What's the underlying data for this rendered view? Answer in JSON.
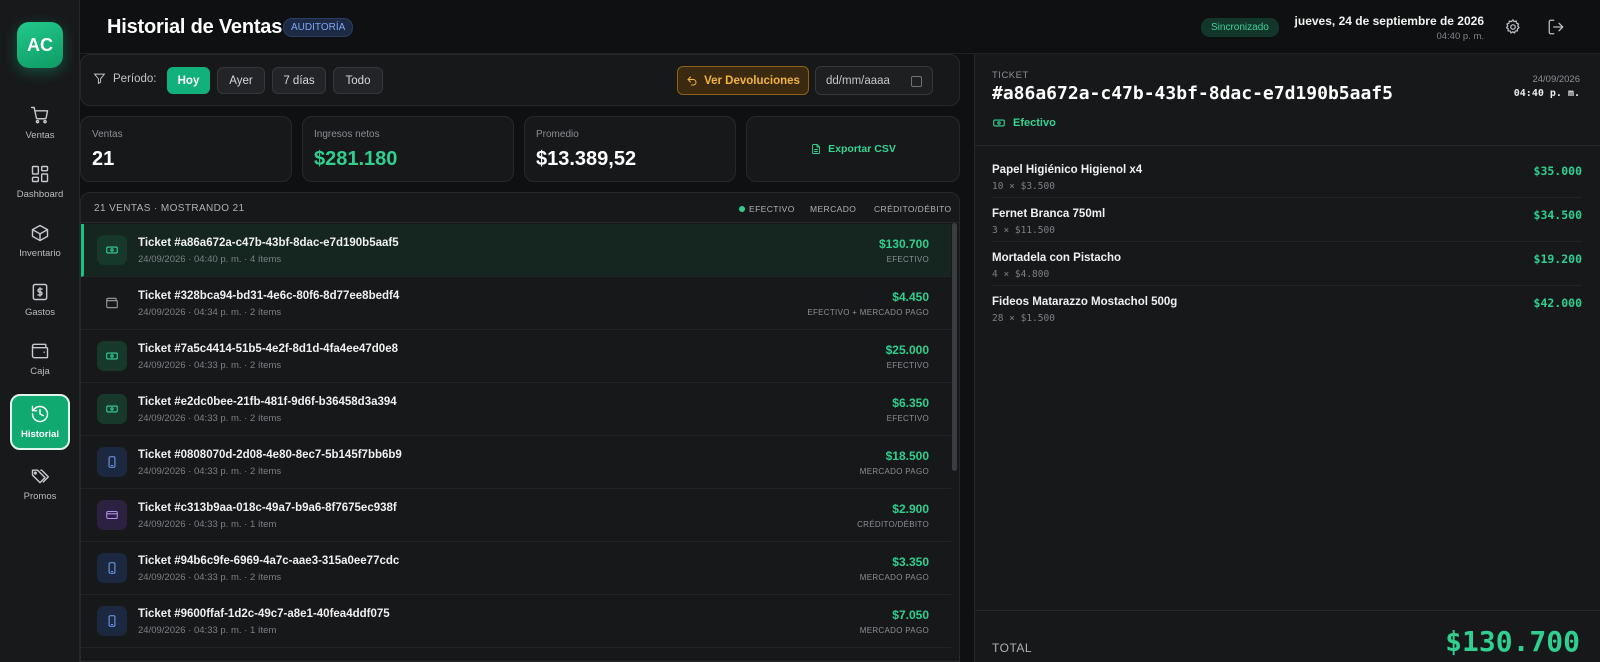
{
  "app": {
    "logo": "AC"
  },
  "sidebar": {
    "items": [
      {
        "label": "Ventas",
        "icon": "cart-icon"
      },
      {
        "label": "Dashboard",
        "icon": "dashboard-icon"
      },
      {
        "label": "Inventario",
        "icon": "box-icon"
      },
      {
        "label": "Gastos",
        "icon": "dollar-icon"
      },
      {
        "label": "Caja",
        "icon": "wallet-icon"
      },
      {
        "label": "Historial",
        "icon": "history-icon",
        "active": true
      },
      {
        "label": "Promos",
        "icon": "tags-icon"
      }
    ]
  },
  "header": {
    "title": "Historial de Ventas",
    "badge": "AUDITORÍA",
    "sync_status": "Sincronizado",
    "date": "jueves, 24 de septiembre de 2026",
    "time": "04:40 p. m."
  },
  "filters": {
    "label": "Período:",
    "periods": [
      "Hoy",
      "Ayer",
      "7 días",
      "Todo"
    ],
    "active_period": "Hoy",
    "returns_button": "Ver Devoluciones",
    "date_placeholder": "dd/mm/aaaa"
  },
  "stats": {
    "sales_label": "Ventas",
    "sales_value": "21",
    "revenue_label": "Ingresos netos",
    "revenue_value": "$281.180",
    "average_label": "Promedio",
    "average_value": "$13.389,52",
    "export_label": "Exportar CSV"
  },
  "list": {
    "count_text": "21 VENTAS · MOSTRANDO 21",
    "legend": [
      "EFECTIVO",
      "MERCADO",
      "CRÉDITO/DÉBITO"
    ],
    "rows": [
      {
        "title": "Ticket #a86a672a-c47b-43bf-8dac-e7d190b5aaf5",
        "sub": "24/09/2026 · 04:40 p. m. · 4 ítems",
        "amount": "$130.700",
        "method": "EFECTIVO",
        "icon": "cash-icon"
      },
      {
        "title": "Ticket #328bca94-bd31-4e6c-80f6-8d77ee8bedf4",
        "sub": "24/09/2026 · 04:34 p. m. · 2 ítems",
        "amount": "$4.450",
        "method": "EFECTIVO + MERCADO PAGO",
        "icon": "wallet-icon"
      },
      {
        "title": "Ticket #7a5c4414-51b5-4e2f-8d1d-4fa4ee47d0e8",
        "sub": "24/09/2026 · 04:33 p. m. · 2 ítems",
        "amount": "$25.000",
        "method": "EFECTIVO",
        "icon": "cash-icon"
      },
      {
        "title": "Ticket #e2dc0bee-21fb-481f-9d6f-b36458d3a394",
        "sub": "24/09/2026 · 04:33 p. m. · 2 ítems",
        "amount": "$6.350",
        "method": "EFECTIVO",
        "icon": "cash-icon"
      },
      {
        "title": "Ticket #0808070d-2d08-4e80-8ec7-5b145f7bb6b9",
        "sub": "24/09/2026 · 04:33 p. m. · 2 ítems",
        "amount": "$18.500",
        "method": "MERCADO PAGO",
        "icon": "phone-icon"
      },
      {
        "title": "Ticket #c313b9aa-018c-49a7-b9a6-8f7675ec938f",
        "sub": "24/09/2026 · 04:33 p. m. · 1 ítem",
        "amount": "$2.900",
        "method": "CRÉDITO/DÉBITO",
        "icon": "credit-card-icon"
      },
      {
        "title": "Ticket #94b6c9fe-6969-4a7c-aae3-315a0ee77cdc",
        "sub": "24/09/2026 · 04:33 p. m. · 2 ítems",
        "amount": "$3.350",
        "method": "MERCADO PAGO",
        "icon": "phone-icon"
      },
      {
        "title": "Ticket #9600ffaf-1d2c-49c7-a8e1-40fea4ddf075",
        "sub": "24/09/2026 · 04:33 p. m. · 1 ítem",
        "amount": "$7.050",
        "method": "MERCADO PAGO",
        "icon": "phone-icon"
      }
    ]
  },
  "detail": {
    "label": "TICKET",
    "id": "#a86a672a-c47b-43bf-8dac-e7d190b5aaf5",
    "date": "24/09/2026",
    "time": "04:40 p. m.",
    "method": "Efectivo",
    "items": [
      {
        "name": "Papel Higiénico Higienol x4",
        "qty": "10 × $3.500",
        "price": "$35.000"
      },
      {
        "name": "Fernet Branca 750ml",
        "qty": "3 × $11.500",
        "price": "$34.500"
      },
      {
        "name": "Mortadela con Pistacho",
        "qty": "4 × $4.800",
        "price": "$19.200"
      },
      {
        "name": "Fideos Matarazzo Mostachol 500g",
        "qty": "28 × $1.500",
        "price": "$42.000"
      }
    ],
    "total_label": "TOTAL",
    "total_value": "$130.700"
  },
  "colors": {
    "accent": "#12b07a",
    "amount": "#2fd08f",
    "warning": "#f4b33d",
    "background": "#0f1011"
  }
}
